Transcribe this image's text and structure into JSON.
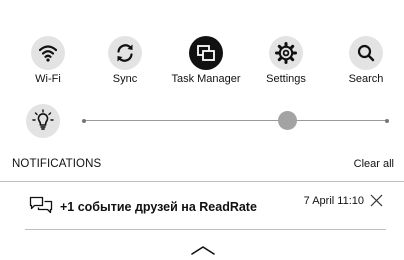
{
  "quick_settings": [
    {
      "label": "Wi-Fi",
      "icon": "wifi-icon",
      "active": false
    },
    {
      "label": "Sync",
      "icon": "sync-icon",
      "active": false
    },
    {
      "label": "Task Manager",
      "icon": "task-manager-icon",
      "active": true
    },
    {
      "label": "Settings",
      "icon": "gear-icon",
      "active": false
    },
    {
      "label": "Search",
      "icon": "search-icon",
      "active": false
    }
  ],
  "brightness": {
    "icon": "lightbulb-icon",
    "level": 0.67
  },
  "notifications": {
    "title": "NOTIFICATIONS",
    "clear_all_label": "Clear all",
    "items": [
      {
        "icon": "chat-bubbles-icon",
        "text": "+1 событие друзей на ReadRate",
        "time": "7 April 11:10"
      }
    ]
  },
  "colors": {
    "active_circle": "#111111",
    "inactive_circle": "#e3e3e3",
    "slider_thumb": "#a3a3a3"
  }
}
